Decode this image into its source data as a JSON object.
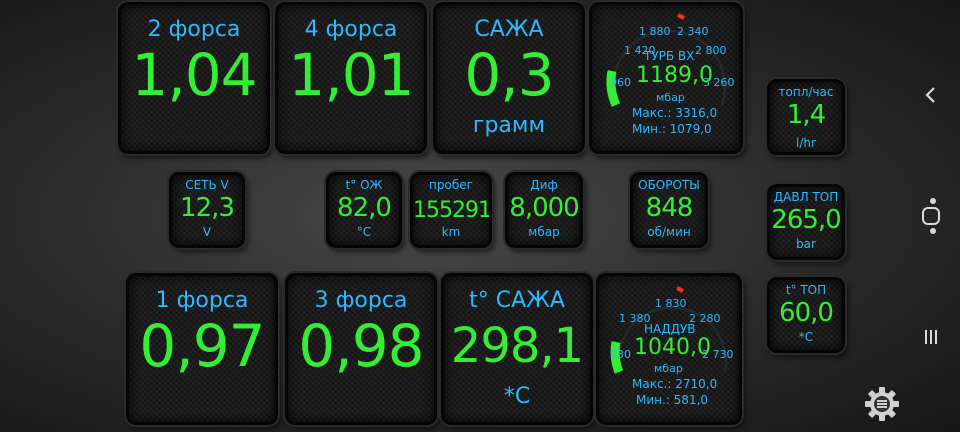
{
  "tiles": {
    "force2": {
      "label": "2 форса",
      "value": "1,04"
    },
    "force4": {
      "label": "4 форса",
      "value": "1,01"
    },
    "soot": {
      "label": "САЖА",
      "value": "0,3",
      "unit": "грамм"
    },
    "force1": {
      "label": "1 форса",
      "value": "0,97"
    },
    "force3": {
      "label": "3 форса",
      "value": "0,98"
    },
    "soot_temp": {
      "label": "t° САЖА",
      "value": "298,1",
      "unit": "*C"
    },
    "fuel_rate": {
      "label": "топл/час",
      "value": "1,4",
      "unit": "l/hr"
    },
    "voltage": {
      "label": "СЕТЬ V",
      "value": "12,3",
      "unit": "V"
    },
    "coolant": {
      "label": "t° ОЖ",
      "value": "82,0",
      "unit": "°C"
    },
    "mileage": {
      "label": "пробег",
      "value": "155291",
      "unit": "km"
    },
    "diff": {
      "label": "Диф",
      "value": "8,000",
      "unit": "мбар"
    },
    "rpm": {
      "label": "ОБОРОТЫ",
      "value": "848",
      "unit": "об/мин"
    },
    "fuel_pressure": {
      "label": "ДАВЛ ТОП",
      "value": "265,0",
      "unit": "bar"
    },
    "fuel_temp": {
      "label": "t° ТОП",
      "value": "60,0",
      "unit": "*C"
    }
  },
  "gauges": {
    "turbo_in": {
      "ticks": [
        "1 880",
        "2 340",
        "1 420",
        "2 800",
        "960",
        "3 260"
      ],
      "label": "ТУРБ ВХ",
      "value": "1189,0",
      "unit": "мбар",
      "max": "Макс.: 3316,0",
      "min": "Мин.: 1079,0",
      "level": 0.15
    },
    "boost": {
      "ticks": [
        "1 830",
        "1 380",
        "2 280",
        "930",
        "2 730"
      ],
      "label": "НАДДУВ",
      "value": "1040,0",
      "unit": "мбар",
      "max": "Макс.: 2710,0",
      "min": "Мин.: 581,0",
      "level": 0.12
    }
  },
  "colors": {
    "label": "#2fb8ff",
    "value": "#33ee33",
    "redline": "#ff2a2a"
  },
  "nav": {
    "back": "chevron-left-icon",
    "home": "home-circle-icon",
    "recents": "recents-icon",
    "settings": "gear-icon"
  }
}
